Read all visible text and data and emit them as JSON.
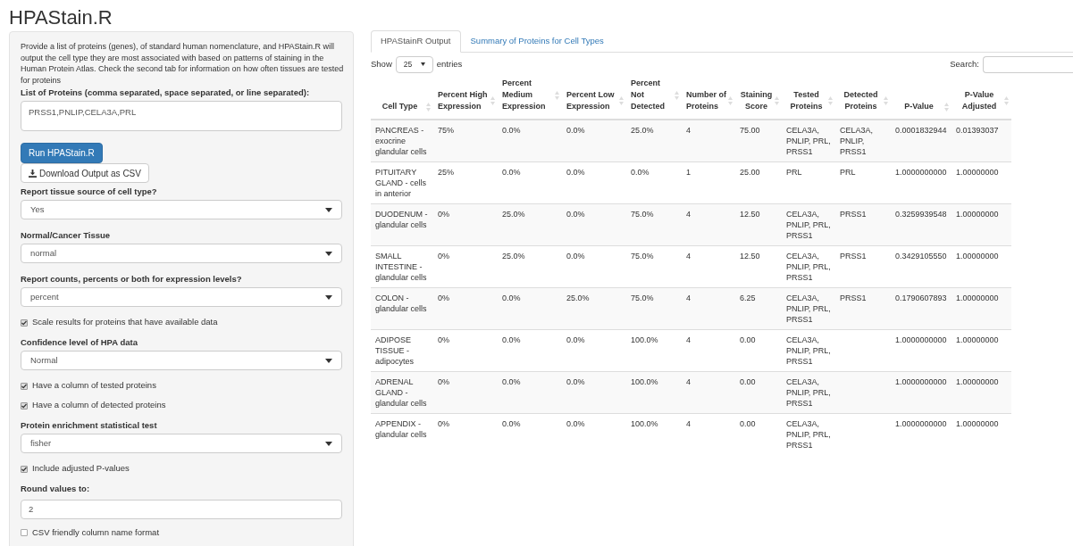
{
  "title": "HPAStain.R",
  "sidebar": {
    "description": "Provide a list of proteins (genes), of standard human nomenclature, and HPAStain.R will output the cell type they are most associated with based on patterns of staining in the Human Protein Atlas. Check the second tab for information on how often tissues are tested for proteins",
    "controls": [
      {
        "kind": "textarea",
        "label": "List of Proteins (comma separated, space separated, or line separated):",
        "value": "PRSS1,PNLIP,CELA3A,PRL"
      },
      {
        "kind": "primary-button",
        "label": "Run HPAStain.R"
      },
      {
        "kind": "download-button",
        "label": "Download Output as CSV"
      },
      {
        "kind": "select",
        "label": "Report tissue source of cell type?",
        "value": "Yes"
      },
      {
        "kind": "select",
        "label": "Normal/Cancer Tissue",
        "value": "normal"
      },
      {
        "kind": "select",
        "label": "Report counts, percents or both for expression levels?",
        "value": "percent"
      },
      {
        "kind": "checkbox",
        "label": "Scale results for proteins that have available data",
        "checked": true
      },
      {
        "kind": "select",
        "label": "Confidence level of HPA data",
        "value": "Normal"
      },
      {
        "kind": "checkbox",
        "label": "Have a column of tested proteins",
        "checked": true
      },
      {
        "kind": "checkbox",
        "label": "Have a column of detected proteins",
        "checked": true
      },
      {
        "kind": "select",
        "label": "Protein enrichment statistical test",
        "value": "fisher"
      },
      {
        "kind": "checkbox",
        "label": "Include adjusted P-values",
        "checked": true
      },
      {
        "kind": "text",
        "label": "Round values to:",
        "value": "2"
      },
      {
        "kind": "checkbox",
        "label": "CSV friendly column name format",
        "checked": false
      }
    ]
  },
  "tabs": [
    {
      "label": "HPAStainR Output",
      "selected": true
    },
    {
      "label": "Summary of Proteins for Cell Types",
      "selected": false
    }
  ],
  "length_menu": {
    "before": "Show",
    "value": "25",
    "after": "entries"
  },
  "search": {
    "label": "Search:"
  },
  "table": {
    "columns": [
      "Cell Type",
      "Percent High Expression",
      "Percent Medium Expression",
      "Percent Low Expression",
      "Percent Not Detected",
      "Number of Proteins",
      "Staining Score",
      "Tested Proteins",
      "Detected Proteins",
      "P-Value",
      "P-Value Adjusted"
    ],
    "rows": [
      [
        "PANCREAS - exocrine glandular cells",
        "75%",
        "0.0%",
        "0.0%",
        "25.0%",
        "4",
        "75.00",
        "CELA3A, PNLIP, PRL, PRSS1",
        "CELA3A, PNLIP, PRSS1",
        "0.0001832944",
        "0.01393037"
      ],
      [
        "PITUITARY GLAND - cells in anterior",
        "25%",
        "0.0%",
        "0.0%",
        "0.0%",
        "1",
        "25.00",
        "PRL",
        "PRL",
        "1.0000000000",
        "1.00000000"
      ],
      [
        "DUODENUM - glandular cells",
        "0%",
        "25.0%",
        "0.0%",
        "75.0%",
        "4",
        "12.50",
        "CELA3A, PNLIP, PRL, PRSS1",
        "PRSS1",
        "0.3259939548",
        "1.00000000"
      ],
      [
        "SMALL INTESTINE - glandular cells",
        "0%",
        "25.0%",
        "0.0%",
        "75.0%",
        "4",
        "12.50",
        "CELA3A, PNLIP, PRL, PRSS1",
        "PRSS1",
        "0.3429105550",
        "1.00000000"
      ],
      [
        "COLON - glandular cells",
        "0%",
        "0.0%",
        "25.0%",
        "75.0%",
        "4",
        "6.25",
        "CELA3A, PNLIP, PRL, PRSS1",
        "PRSS1",
        "0.1790607893",
        "1.00000000"
      ],
      [
        "ADIPOSE TISSUE - adipocytes",
        "0%",
        "0.0%",
        "0.0%",
        "100.0%",
        "4",
        "0.00",
        "CELA3A, PNLIP, PRL, PRSS1",
        "",
        "1.0000000000",
        "1.00000000"
      ],
      [
        "ADRENAL GLAND - glandular cells",
        "0%",
        "0.0%",
        "0.0%",
        "100.0%",
        "4",
        "0.00",
        "CELA3A, PNLIP, PRL, PRSS1",
        "",
        "1.0000000000",
        "1.00000000"
      ],
      [
        "APPENDIX - glandular cells",
        "0%",
        "0.0%",
        "0.0%",
        "100.0%",
        "4",
        "0.00",
        "CELA3A, PNLIP, PRL, PRSS1",
        "",
        "1.0000000000",
        "1.00000000"
      ]
    ]
  }
}
